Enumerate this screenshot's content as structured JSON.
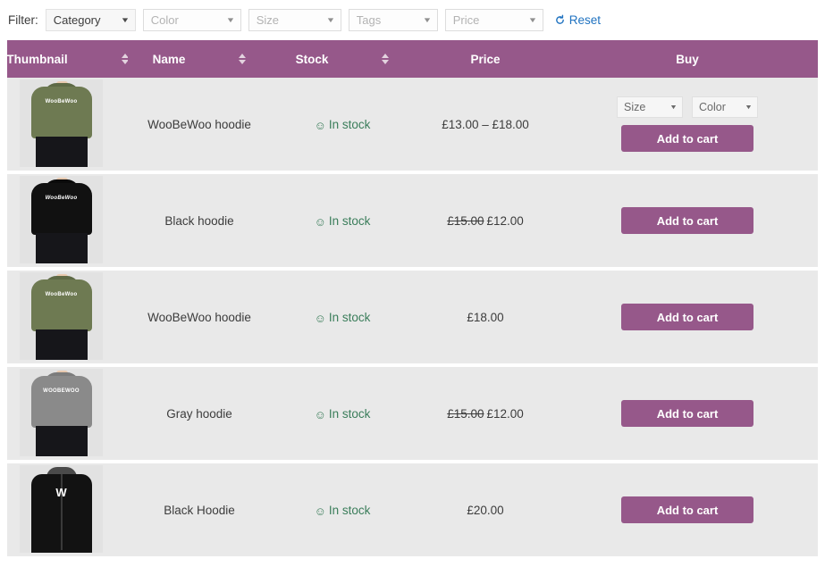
{
  "filter_bar": {
    "label": "Filter:",
    "selects": [
      {
        "name": "category",
        "text": "Category",
        "active": true
      },
      {
        "name": "color",
        "text": "Color",
        "active": false
      },
      {
        "name": "size",
        "text": "Size",
        "active": false
      },
      {
        "name": "tags",
        "text": "Tags",
        "active": false
      },
      {
        "name": "price",
        "text": "Price",
        "active": false
      }
    ],
    "reset": {
      "label": "Reset",
      "icon": "reset-arrow-icon",
      "color": "#1f72c0"
    }
  },
  "table": {
    "header_color": "#96588a",
    "columns": [
      {
        "key": "thumbnail",
        "label": "Thumbnail",
        "sortable": true
      },
      {
        "key": "name",
        "label": "Name",
        "sortable": true
      },
      {
        "key": "stock",
        "label": "Stock",
        "sortable": true
      },
      {
        "key": "price",
        "label": "Price",
        "sortable": false
      },
      {
        "key": "buy",
        "label": "Buy",
        "sortable": false
      }
    ],
    "rows": [
      {
        "thumbnail": {
          "icon": "product-thumbnail-olive-hoodie",
          "alt": "Olive green cropped hoodie",
          "hoodie_color": "#6e7a52",
          "logo": "WooBeWoo",
          "style": "crop"
        },
        "name": "WooBeWoo hoodie",
        "stock": {
          "icon": "smiley-icon",
          "text": "In stock"
        },
        "price": {
          "regular": "",
          "sale": "",
          "range": "£13.00 – £18.00"
        },
        "buy": {
          "variations": [
            {
              "name": "size",
              "text": "Size"
            },
            {
              "name": "color",
              "text": "Color"
            }
          ],
          "button": "Add to cart"
        }
      },
      {
        "thumbnail": {
          "icon": "product-thumbnail-black-hoodie",
          "alt": "Black cropped hoodie",
          "hoodie_color": "#111111",
          "logo": "WooBeWoo",
          "style": "crop"
        },
        "name": "Black hoodie",
        "stock": {
          "icon": "smiley-icon",
          "text": "In stock"
        },
        "price": {
          "regular": "£15.00",
          "sale": "£12.00",
          "range": ""
        },
        "buy": {
          "variations": [],
          "button": "Add to cart"
        }
      },
      {
        "thumbnail": {
          "icon": "product-thumbnail-olive-hoodie",
          "alt": "Olive green cropped hoodie",
          "hoodie_color": "#6e7a52",
          "logo": "WooBeWoo",
          "style": "crop"
        },
        "name": "WooBeWoo hoodie",
        "stock": {
          "icon": "smiley-icon",
          "text": "In stock"
        },
        "price": {
          "regular": "",
          "sale": "",
          "range": "£18.00"
        },
        "buy": {
          "variations": [],
          "button": "Add to cart"
        }
      },
      {
        "thumbnail": {
          "icon": "product-thumbnail-gray-hoodie",
          "alt": "Gray cropped hoodie",
          "hoodie_color": "#8a8a8a",
          "logo": "WOOBEWOO",
          "style": "crop"
        },
        "name": "Gray hoodie",
        "stock": {
          "icon": "smiley-icon",
          "text": "In stock"
        },
        "price": {
          "regular": "£15.00",
          "sale": "£12.00",
          "range": ""
        },
        "buy": {
          "variations": [],
          "button": "Add to cart"
        }
      },
      {
        "thumbnail": {
          "icon": "product-thumbnail-black-zip-hoodie",
          "alt": "Black zip-up hoodie",
          "hoodie_color": "#121212",
          "logo": "W",
          "style": "zip"
        },
        "name": "Black Hoodie",
        "stock": {
          "icon": "smiley-icon",
          "text": "In stock"
        },
        "price": {
          "regular": "",
          "sale": "",
          "range": "£20.00"
        },
        "buy": {
          "variations": [],
          "button": "Add to cart"
        }
      }
    ]
  }
}
